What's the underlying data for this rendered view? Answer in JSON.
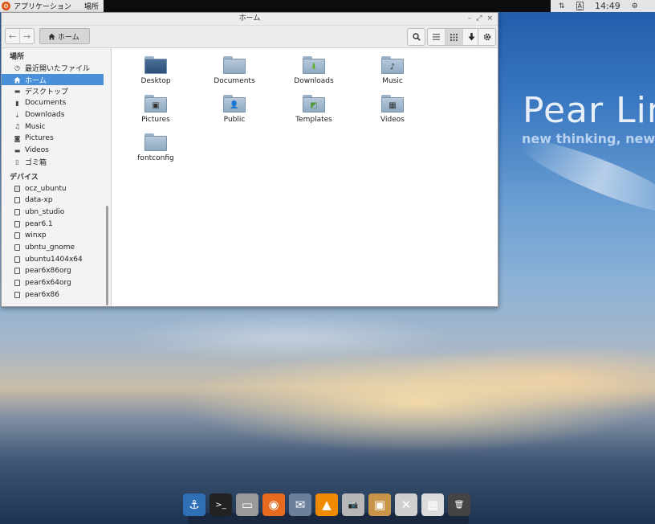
{
  "top_panel": {
    "apps_label": "アプリケーション",
    "places_label": "場所",
    "tray": {
      "network": "⇅",
      "input_method": "A̲",
      "clock": "14:49",
      "settings": "⚙"
    }
  },
  "window": {
    "title": "ホーム",
    "controls": {
      "minimize": "–",
      "maximize": "⤢",
      "close": "×"
    },
    "toolbar": {
      "back": "◀",
      "forward": "▶",
      "breadcrumb": "ホーム",
      "search": "search-icon",
      "list_view": "list-icon",
      "grid_view": "grid-icon",
      "download": "download-icon",
      "menu": "gear-icon"
    },
    "sidebar": {
      "places_header": "場所",
      "places": [
        {
          "label": "最近開いたファイル",
          "icon": "clock-icon"
        },
        {
          "label": "ホーム",
          "icon": "home-icon",
          "selected": true
        },
        {
          "label": "デスクトップ",
          "icon": "desktop-folder-icon"
        },
        {
          "label": "Documents",
          "icon": "document-icon"
        },
        {
          "label": "Downloads",
          "icon": "download-icon"
        },
        {
          "label": "Music",
          "icon": "music-icon"
        },
        {
          "label": "Pictures",
          "icon": "camera-icon"
        },
        {
          "label": "Videos",
          "icon": "video-icon"
        },
        {
          "label": "ゴミ箱",
          "icon": "trash-icon"
        }
      ],
      "devices_header": "デバイス",
      "devices": [
        {
          "label": "ocz_ubuntu",
          "icon": "drive-icon"
        },
        {
          "label": "data-xp",
          "icon": "drive-icon"
        },
        {
          "label": "ubn_studio",
          "icon": "drive-icon"
        },
        {
          "label": "pear6.1",
          "icon": "drive-icon"
        },
        {
          "label": "winxp",
          "icon": "drive-icon"
        },
        {
          "label": "ubntu_gnome",
          "icon": "drive-icon"
        },
        {
          "label": "ubuntu1404x64",
          "icon": "drive-icon"
        },
        {
          "label": "pear6x86org",
          "icon": "drive-icon"
        },
        {
          "label": "pear6x64org",
          "icon": "drive-icon"
        },
        {
          "label": "pear6x86",
          "icon": "drive-icon"
        }
      ]
    },
    "files": [
      {
        "name": "Desktop",
        "emblem": ""
      },
      {
        "name": "Documents",
        "emblem": ""
      },
      {
        "name": "Downloads",
        "emblem": "⬇"
      },
      {
        "name": "Music",
        "emblem": "♪"
      },
      {
        "name": "Pictures",
        "emblem": "▣"
      },
      {
        "name": "Public",
        "emblem": "👤"
      },
      {
        "name": "Templates",
        "emblem": "◩"
      },
      {
        "name": "Videos",
        "emblem": "▦"
      },
      {
        "name": "fontconfig",
        "emblem": ""
      }
    ]
  },
  "wallpaper": {
    "brand_title": "Pear Lin",
    "brand_subtitle": "new thinking, new p"
  },
  "dock": {
    "items": [
      {
        "name": "anchor-icon",
        "glyph": "⚓",
        "color": "#2f6fb5"
      },
      {
        "name": "terminal-icon",
        "glyph": ">_",
        "color": "#222222"
      },
      {
        "name": "drive-icon",
        "glyph": "▭",
        "color": "#9a9a9a"
      },
      {
        "name": "firefox-icon",
        "glyph": "◉",
        "color": "#e66b1e"
      },
      {
        "name": "mail-icon",
        "glyph": "✉",
        "color": "#6a7f9a"
      },
      {
        "name": "vlc-icon",
        "glyph": "▲",
        "color": "#f08a00"
      },
      {
        "name": "camera-icon",
        "glyph": "📷",
        "color": "#b7b7b7"
      },
      {
        "name": "package-icon",
        "glyph": "▣",
        "color": "#c8944a"
      },
      {
        "name": "tools-icon",
        "glyph": "✕",
        "color": "#cfcfcf"
      },
      {
        "name": "calculator-icon",
        "glyph": "▦",
        "color": "#dcdcdc"
      },
      {
        "name": "trash-icon",
        "glyph": "🗑",
        "color": "#444444"
      }
    ]
  }
}
